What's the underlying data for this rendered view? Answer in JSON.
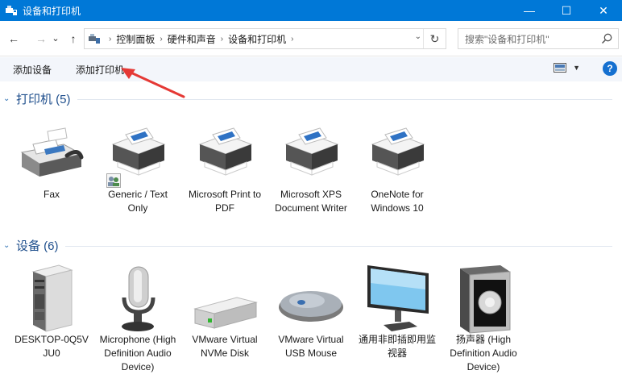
{
  "window": {
    "title": "设备和打印机"
  },
  "title_controls": {
    "minimize": "—",
    "maximize": "☐",
    "close": "✕"
  },
  "nav": {
    "back": "←",
    "forward": "→",
    "recent": "⌄",
    "up": "↑"
  },
  "address": {
    "crumbs": [
      "控制面板",
      "硬件和声音",
      "设备和打印机"
    ],
    "separator": "›",
    "dropdown": "⌄",
    "refresh": "↻"
  },
  "search": {
    "placeholder": "搜索\"设备和打印机\""
  },
  "commands": {
    "add_device": "添加设备",
    "add_printer": "添加打印机"
  },
  "view": {
    "dropdown": "▼"
  },
  "help": {
    "label": "?"
  },
  "groups": [
    {
      "chevron": "⌄",
      "label": "打印机 (5)",
      "items": [
        {
          "label": "Fax",
          "icon": "fax-icon"
        },
        {
          "label": "Generic / Text Only",
          "icon": "printer-icon"
        },
        {
          "label": "Microsoft Print to PDF",
          "icon": "printer-icon"
        },
        {
          "label": "Microsoft XPS Document Writer",
          "icon": "printer-icon"
        },
        {
          "label": "OneNote for Windows 10",
          "icon": "printer-icon"
        }
      ]
    },
    {
      "chevron": "⌄",
      "label": "设备 (6)",
      "items": [
        {
          "label": "DESKTOP-0Q5V JU0",
          "icon": "computer-tower-icon"
        },
        {
          "label": "Microphone (High Definition Audio Device)",
          "icon": "microphone-icon"
        },
        {
          "label": "VMware Virtual NVMe Disk",
          "icon": "disk-drive-icon"
        },
        {
          "label": "VMware Virtual USB Mouse",
          "icon": "mouse-icon"
        },
        {
          "label": "通用非即插即用监视器",
          "icon": "monitor-icon"
        },
        {
          "label": "扬声器 (High Definition Audio Device)",
          "icon": "speaker-icon"
        }
      ]
    }
  ],
  "colors": {
    "titlebar": "#0078d7",
    "commandbar": "#f3f6fb",
    "group_text": "#1e4e8c",
    "annotation": "#e53935"
  }
}
